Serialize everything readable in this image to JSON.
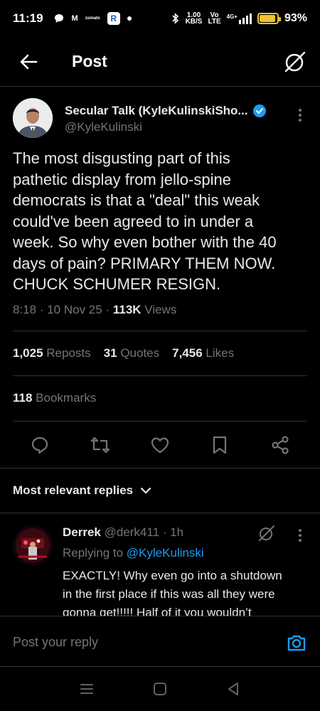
{
  "status_bar": {
    "time": "11:19",
    "chip_m": "M",
    "chip_small": "zomato",
    "chip_r": "R",
    "speed_top": "1.00",
    "speed_bottom": "KB/S",
    "net_top": "Vo",
    "net_bottom": "LTE",
    "signal": "4G+",
    "battery_level": 0.93,
    "battery_pct": "93%",
    "accent_color": "#f1c232"
  },
  "header": {
    "title": "Post",
    "back_icon": "arrow-left-icon",
    "grok_icon": "grok-icon"
  },
  "post": {
    "author_name": "Secular Talk (KyleKulinskiSho...",
    "author_handle": "@KyleKulinski",
    "verified_color": "#1d9bf0",
    "text": "The most disgusting part of this\npathetic display from jello-spine\ndemocrats is that a \"deal\" this weak\ncould've been agreed to in under a\nweek. So why even bother with the 40\ndays of pain? PRIMARY THEM NOW.\nCHUCK SCHUMER RESIGN.",
    "time": "8:18",
    "date": "10 Nov 25",
    "views_count": "113K",
    "views_label": "Views",
    "reposts_count": "1,025",
    "reposts_label": "Reposts",
    "quotes_count": "31",
    "quotes_label": "Quotes",
    "likes_count": "7,456",
    "likes_label": "Likes",
    "bookmarks_count": "118",
    "bookmarks_label": "Bookmarks"
  },
  "actions": [
    "reply-icon",
    "repost-icon",
    "like-icon",
    "bookmark-icon",
    "share-icon"
  ],
  "sort": {
    "label": "Most relevant replies"
  },
  "reply": {
    "name": "Derrek",
    "handle": "@derk411",
    "age": "1h",
    "replying_prefix": "Replying to",
    "replying_to": "@KyleKulinski",
    "text": "EXACTLY! Why even go into a shutdown\nin the first place if this was all they were\ngonna get!!!!! Half of it you wouldn’t"
  },
  "composer": {
    "placeholder": "Post your reply",
    "camera_icon": "camera-icon"
  },
  "navbar": [
    "menu-icon",
    "home-square-icon",
    "back-triangle-icon"
  ]
}
